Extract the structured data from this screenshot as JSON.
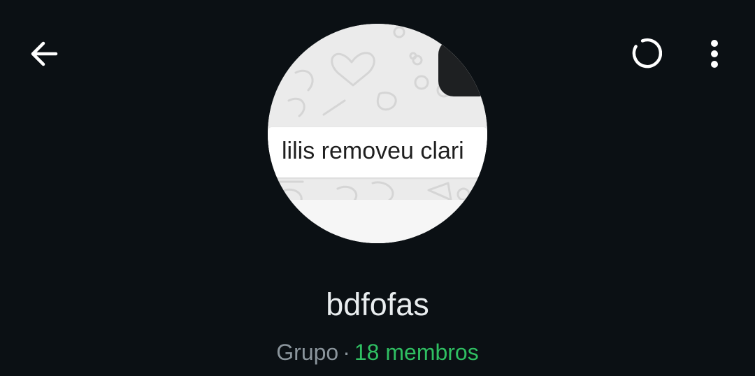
{
  "header": {
    "back_icon": "arrow-left-icon",
    "refresh_icon": "loading-spinner-icon",
    "menu_icon": "more-vertical-icon"
  },
  "avatar": {
    "image_text": "lilis removeu clari"
  },
  "group": {
    "name": "bdfofas",
    "type": "Grupo",
    "separator": "·",
    "members": "18 membros"
  },
  "colors": {
    "background": "#0b1014",
    "text_primary": "#e9edef",
    "text_secondary": "#8b959c",
    "accent": "#2fbf62"
  }
}
